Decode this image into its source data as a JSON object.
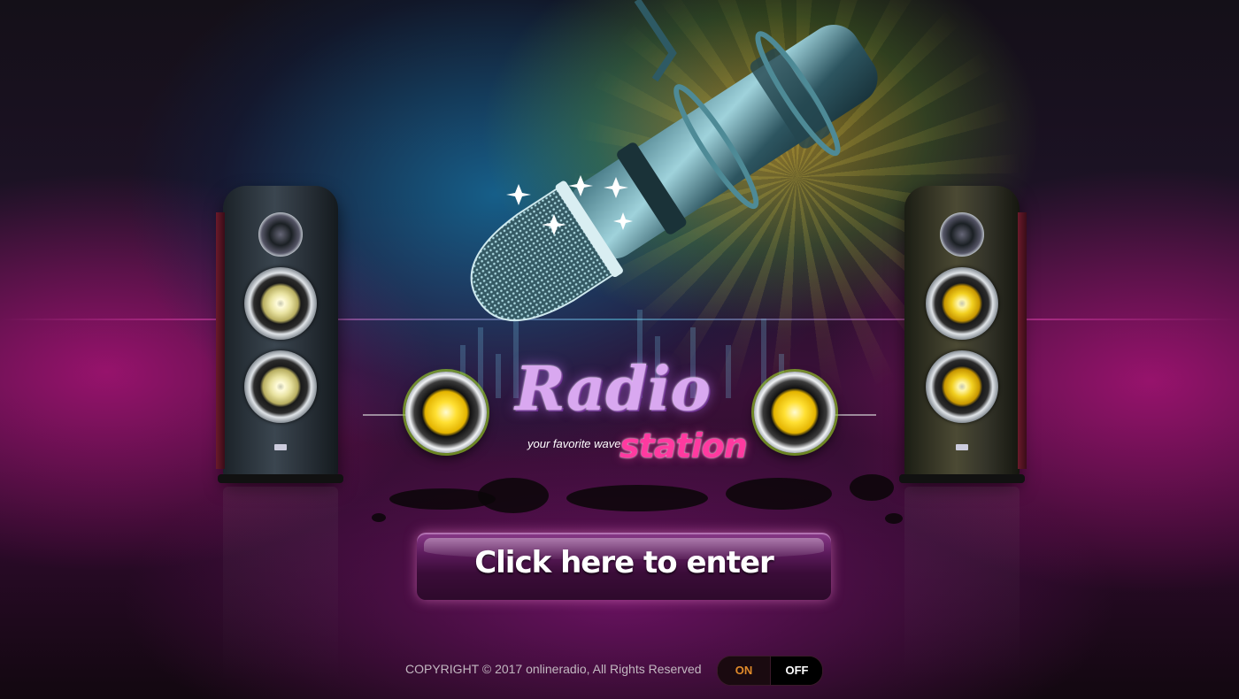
{
  "logo": {
    "title": "Radio",
    "tagline": "your favorite wave",
    "station": "station"
  },
  "enter_button": {
    "label": "Click here to enter"
  },
  "footer": {
    "copyright": "COPYRIGHT © 2017 onlineradio, All Rights Reserved",
    "toggle": {
      "on_label": "ON",
      "off_label": "OFF"
    }
  },
  "colors": {
    "accent_pink": "#ff3aa0",
    "accent_violet": "#d9a8f0",
    "toggle_on": "#e08a2a"
  }
}
